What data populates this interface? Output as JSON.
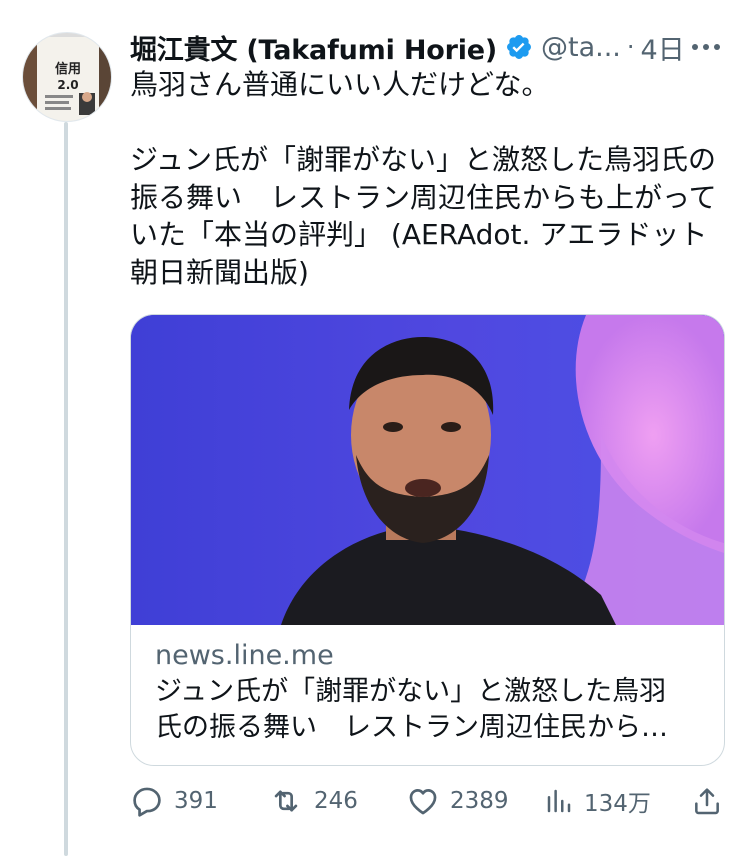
{
  "tweet": {
    "author": {
      "display_name": "堀江貴文 (Takafumi Horie)",
      "handle": "@ta...",
      "verified": true,
      "avatar_text_1": "信用",
      "avatar_text_2": "2.0"
    },
    "separator": "·",
    "time": "4日",
    "text_lines": [
      "鳥羽さん普通にいい人だけどな。",
      "",
      "ジュン氏が「謝罪がない」と激怒した鳥羽氏の",
      "振る舞い　レストラン周辺住民からも上がって",
      "いた「本当の評判」 (AERAdot. アエラドット",
      "朝日新聞出版)"
    ],
    "card": {
      "domain": "news.line.me",
      "title_lines": [
        "ジュン氏が「謝罪がない」と激怒した鳥羽",
        "氏の振る舞い　レストラン周辺住民から…"
      ]
    },
    "actions": {
      "replies": "391",
      "retweets": "246",
      "likes": "2389",
      "views": "134万"
    }
  },
  "colors": {
    "text": "#0f1419",
    "secondary": "#536471",
    "verified": "#1d9bf0",
    "border": "#cfd9de"
  },
  "icons": [
    "verified-badge-icon",
    "more-icon",
    "reply-icon",
    "retweet-icon",
    "like-icon",
    "views-icon",
    "share-icon"
  ]
}
